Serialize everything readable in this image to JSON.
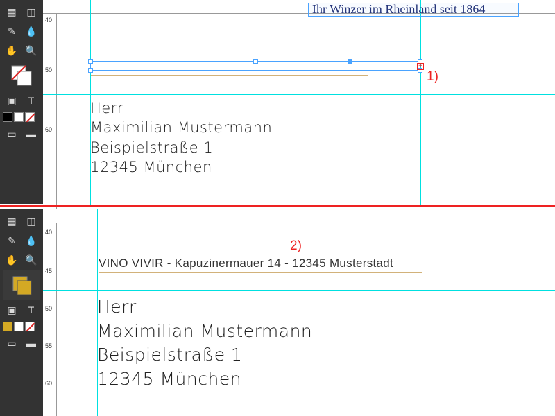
{
  "tagline": "Ihr Winzer im Rheinland seit 1864",
  "address": {
    "line1": "Herr",
    "line2": "Maximilian Mustermann",
    "line3": "Beispielstraße 1",
    "line4": "12345 München"
  },
  "sender_line": "VINO VIVIR - Kapuzinermauer 14 - 12345 Musterstadt",
  "annotations": {
    "a1": "1)",
    "a2": "2)"
  },
  "ruler_v_top": {
    "t1": "40",
    "t2": "50",
    "t3": "60"
  },
  "ruler_v_bot": {
    "t1": "40",
    "t2": "45",
    "t3": "50",
    "t4": "55",
    "t5": "60"
  },
  "tools": {
    "move": "↔",
    "select": "▭",
    "pen": "✒",
    "eyedrop": "✎",
    "hand": "✋",
    "zoom": "🔍",
    "text": "T",
    "rect": "▢"
  }
}
